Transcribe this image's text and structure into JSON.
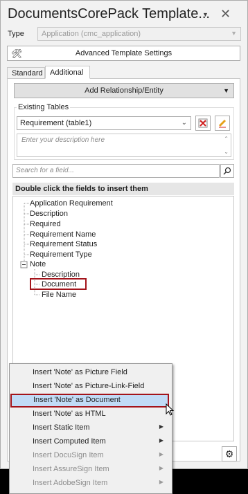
{
  "window": {
    "title": "DocumentsCorePack Template...",
    "pin_icon": "pin-dropdown-icon",
    "close_glyph": "✕"
  },
  "type": {
    "label": "Type",
    "value": "Application (cmc_application)"
  },
  "advanced_button": {
    "label": "Advanced Template Settings"
  },
  "tabs": [
    {
      "label": "Standard"
    },
    {
      "label": "Additional"
    }
  ],
  "relationship_button": {
    "label": "Add Relationship/Entity"
  },
  "existing_tables": {
    "label": "Existing  Tables",
    "selected": "Requirement  (table1)",
    "description_placeholder": "Enter your description here"
  },
  "search": {
    "placeholder": "Search for a field..."
  },
  "hint": "Double click the fields to insert them",
  "tree": [
    {
      "label": "Application Requirement"
    },
    {
      "label": "Description"
    },
    {
      "label": "Required"
    },
    {
      "label": "Requirement Name"
    },
    {
      "label": "Requirement Status"
    },
    {
      "label": "Requirement Type"
    },
    {
      "label": "Note"
    },
    {
      "label": "Description"
    },
    {
      "label": "Document"
    },
    {
      "label": "File Name"
    }
  ],
  "context_menu": [
    {
      "label": "Insert 'Note' as Picture Field"
    },
    {
      "label": "Insert 'Note' as Picture-Link-Field"
    },
    {
      "label": "Insert 'Note' as Document"
    },
    {
      "label": "Insert 'Note' as HTML"
    },
    {
      "label": "Insert Static Item"
    },
    {
      "label": "Insert Computed Item"
    },
    {
      "label": "Insert DocuSign Item"
    },
    {
      "label": "Insert AssureSign Item"
    },
    {
      "label": "Insert AdobeSign Item"
    }
  ],
  "colors": {
    "highlight_border": "#a3141b",
    "selected_bg": "#c1dbf6"
  }
}
